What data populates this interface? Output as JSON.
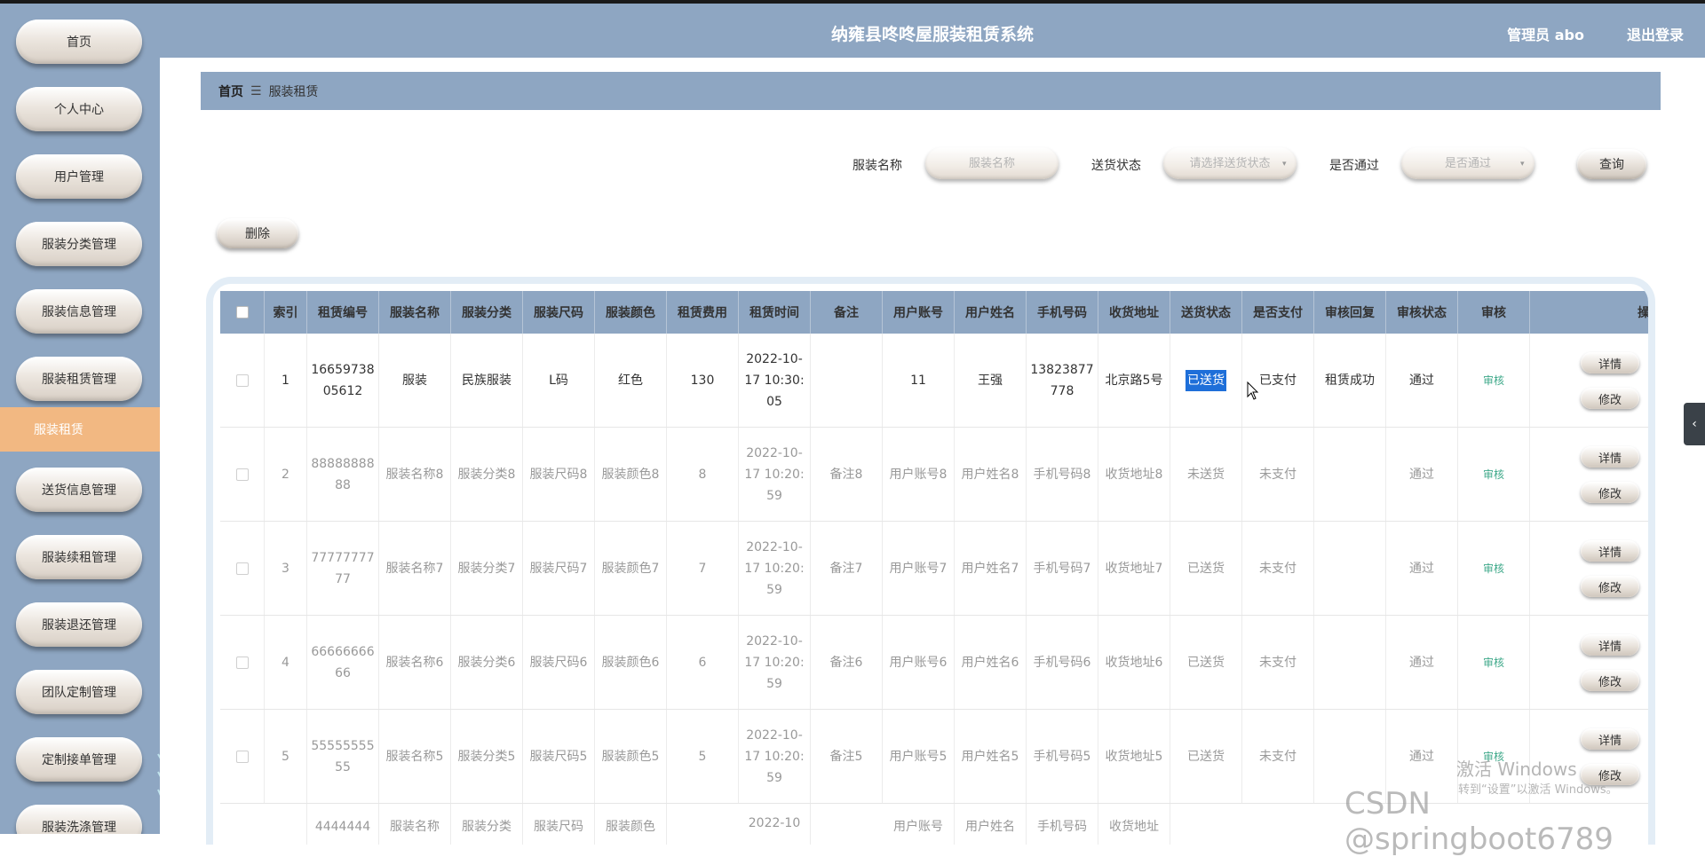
{
  "header": {
    "title": "纳雍县咚咚屋服装租赁系统",
    "user": "管理员 abo",
    "logout": "退出登录"
  },
  "sidebar": {
    "items": [
      "首页",
      "个人中心",
      "用户管理",
      "服装分类管理",
      "服装信息管理",
      "服装租赁管理"
    ],
    "active": "服装租赁",
    "items_after": [
      "送货信息管理",
      "服装续租管理",
      "服装退还管理",
      "团队定制管理",
      "定制接单管理",
      "服装洗涤管理"
    ]
  },
  "breadcrumb": {
    "home": "首页",
    "separator": "☰",
    "current": "服装租赁"
  },
  "search": {
    "name_label": "服装名称",
    "name_placeholder": "服装名称",
    "delivery_label": "送货状态",
    "delivery_placeholder": "请选择送货状态",
    "pass_label": "是否通过",
    "pass_placeholder": "是否通过",
    "query_button": "查询"
  },
  "toolbar": {
    "delete_button": "删除"
  },
  "table": {
    "headers": [
      "索引",
      "租赁编号",
      "服装名称",
      "服装分类",
      "服装尺码",
      "服装颜色",
      "租赁费用",
      "租赁时间",
      "备注",
      "用户账号",
      "用户姓名",
      "手机号码",
      "收货地址",
      "送货状态",
      "是否支付",
      "审核回复",
      "审核状态",
      "审核",
      "操"
    ],
    "rows": [
      [
        "1",
        "1665973805612",
        "服装",
        "民族服装",
        "L码",
        "红色",
        "130",
        "2022-10-17 10:30:05",
        "",
        "11",
        "王强",
        "13823877778",
        "北京路5号",
        "已送货",
        "已支付",
        "租赁成功",
        "通过",
        "审核"
      ],
      [
        "2",
        "8888888888",
        "服装名称8",
        "服装分类8",
        "服装尺码8",
        "服装颜色8",
        "8",
        "2022-10-17 10:20:59",
        "备注8",
        "用户账号8",
        "用户姓名8",
        "手机号码8",
        "收货地址8",
        "未送货",
        "未支付",
        "",
        "通过",
        "审核"
      ],
      [
        "3",
        "7777777777",
        "服装名称7",
        "服装分类7",
        "服装尺码7",
        "服装颜色7",
        "7",
        "2022-10-17 10:20:59",
        "备注7",
        "用户账号7",
        "用户姓名7",
        "手机号码7",
        "收货地址7",
        "已送货",
        "未支付",
        "",
        "通过",
        "审核"
      ],
      [
        "4",
        "6666666666",
        "服装名称6",
        "服装分类6",
        "服装尺码6",
        "服装颜色6",
        "6",
        "2022-10-17 10:20:59",
        "备注6",
        "用户账号6",
        "用户姓名6",
        "手机号码6",
        "收货地址6",
        "已送货",
        "未支付",
        "",
        "通过",
        "审核"
      ],
      [
        "5",
        "5555555555",
        "服装名称5",
        "服装分类5",
        "服装尺码5",
        "服装颜色5",
        "5",
        "2022-10-17 10:20:59",
        "备注5",
        "用户账号5",
        "用户姓名5",
        "手机号码5",
        "收货地址5",
        "已送货",
        "未支付",
        "",
        "通过",
        "审核"
      ],
      [
        "",
        "4444444",
        "服装名称",
        "服装分类",
        "服装尺码",
        "服装颜色",
        "",
        "2022-10",
        "",
        "用户账号",
        "用户姓名",
        "手机号码",
        "收货地址",
        "",
        "",
        "",
        "",
        ""
      ]
    ],
    "detail_button": "详情",
    "edit_button": "修改"
  },
  "watermark": {
    "windows_line1": "激活 Windows",
    "windows_line2": "转到“设置”以激活 Windows。",
    "csdn": "CSDN @springboot6789"
  },
  "colors": {
    "primary": "#8ea6c2",
    "active": "#f2b882",
    "audit": "#3fa98a",
    "highlight": "#1e6fd9"
  },
  "icons": {
    "collapse": "chevron-left-icon"
  }
}
